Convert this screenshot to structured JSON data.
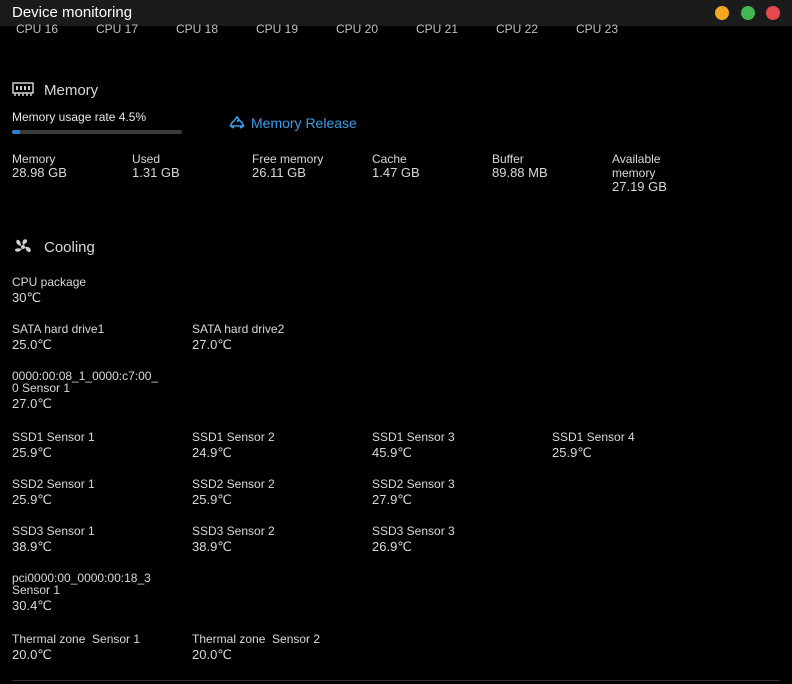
{
  "window": {
    "title": "Device monitoring",
    "controls": [
      {
        "name": "minimize-button",
        "color": "#f5a623"
      },
      {
        "name": "maximize-button",
        "color": "#3fb950"
      },
      {
        "name": "close-button",
        "color": "#e5484d"
      }
    ]
  },
  "cpu_labels": [
    "CPU 16",
    "CPU 17",
    "CPU 18",
    "CPU 19",
    "CPU 20",
    "CPU 21",
    "CPU 22",
    "CPU 23"
  ],
  "memory": {
    "heading": "Memory",
    "icon": "memory-chip-icon",
    "usage_label": "Memory usage rate 4.5%",
    "usage_percent": 4.5,
    "release_label": "Memory Release",
    "release_icon": "recycle-icon",
    "stats": [
      {
        "label": "Memory",
        "value": "28.98 GB"
      },
      {
        "label": "Used",
        "value": "1.31 GB"
      },
      {
        "label": "Free memory",
        "value": "26.11 GB"
      },
      {
        "label": "Cache",
        "value": "1.47 GB"
      },
      {
        "label": "Buffer",
        "value": "89.88 MB"
      },
      {
        "label": "Available memory",
        "value": "27.19 GB"
      }
    ]
  },
  "cooling": {
    "heading": "Cooling",
    "icon": "fan-icon",
    "rows": [
      [
        {
          "label": "CPU package",
          "value": "30℃"
        }
      ],
      [
        {
          "label": "SATA hard drive1",
          "value": "25.0℃"
        },
        {
          "label": "SATA hard drive2",
          "value": "27.0℃"
        }
      ],
      [
        {
          "label": "0000:00:08_1_0000:c7:00_0 Sensor 1",
          "value": "27.0℃"
        }
      ],
      [
        {
          "label": "SSD1 Sensor 1",
          "value": "25.9℃"
        },
        {
          "label": "SSD1 Sensor 2",
          "value": "24.9℃"
        },
        {
          "label": "SSD1 Sensor 3",
          "value": "45.9℃"
        },
        {
          "label": "SSD1 Sensor 4",
          "value": "25.9℃"
        }
      ],
      [
        {
          "label": "SSD2 Sensor 1",
          "value": "25.9℃"
        },
        {
          "label": "SSD2 Sensor 2",
          "value": "25.9℃"
        },
        {
          "label": "SSD2 Sensor 3",
          "value": "27.9℃"
        }
      ],
      [
        {
          "label": "SSD3 Sensor 1",
          "value": "38.9℃"
        },
        {
          "label": "SSD3 Sensor 2",
          "value": "38.9℃"
        },
        {
          "label": "SSD3 Sensor 3",
          "value": "26.9℃"
        }
      ],
      [
        {
          "label": "pci0000:00_0000:00:18_3 Sensor 1",
          "value": "30.4℃"
        }
      ],
      [
        {
          "label": "Thermal zone  Sensor 1",
          "value": "20.0℃"
        },
        {
          "label": "Thermal zone  Sensor 2",
          "value": "20.0℃"
        }
      ]
    ]
  }
}
